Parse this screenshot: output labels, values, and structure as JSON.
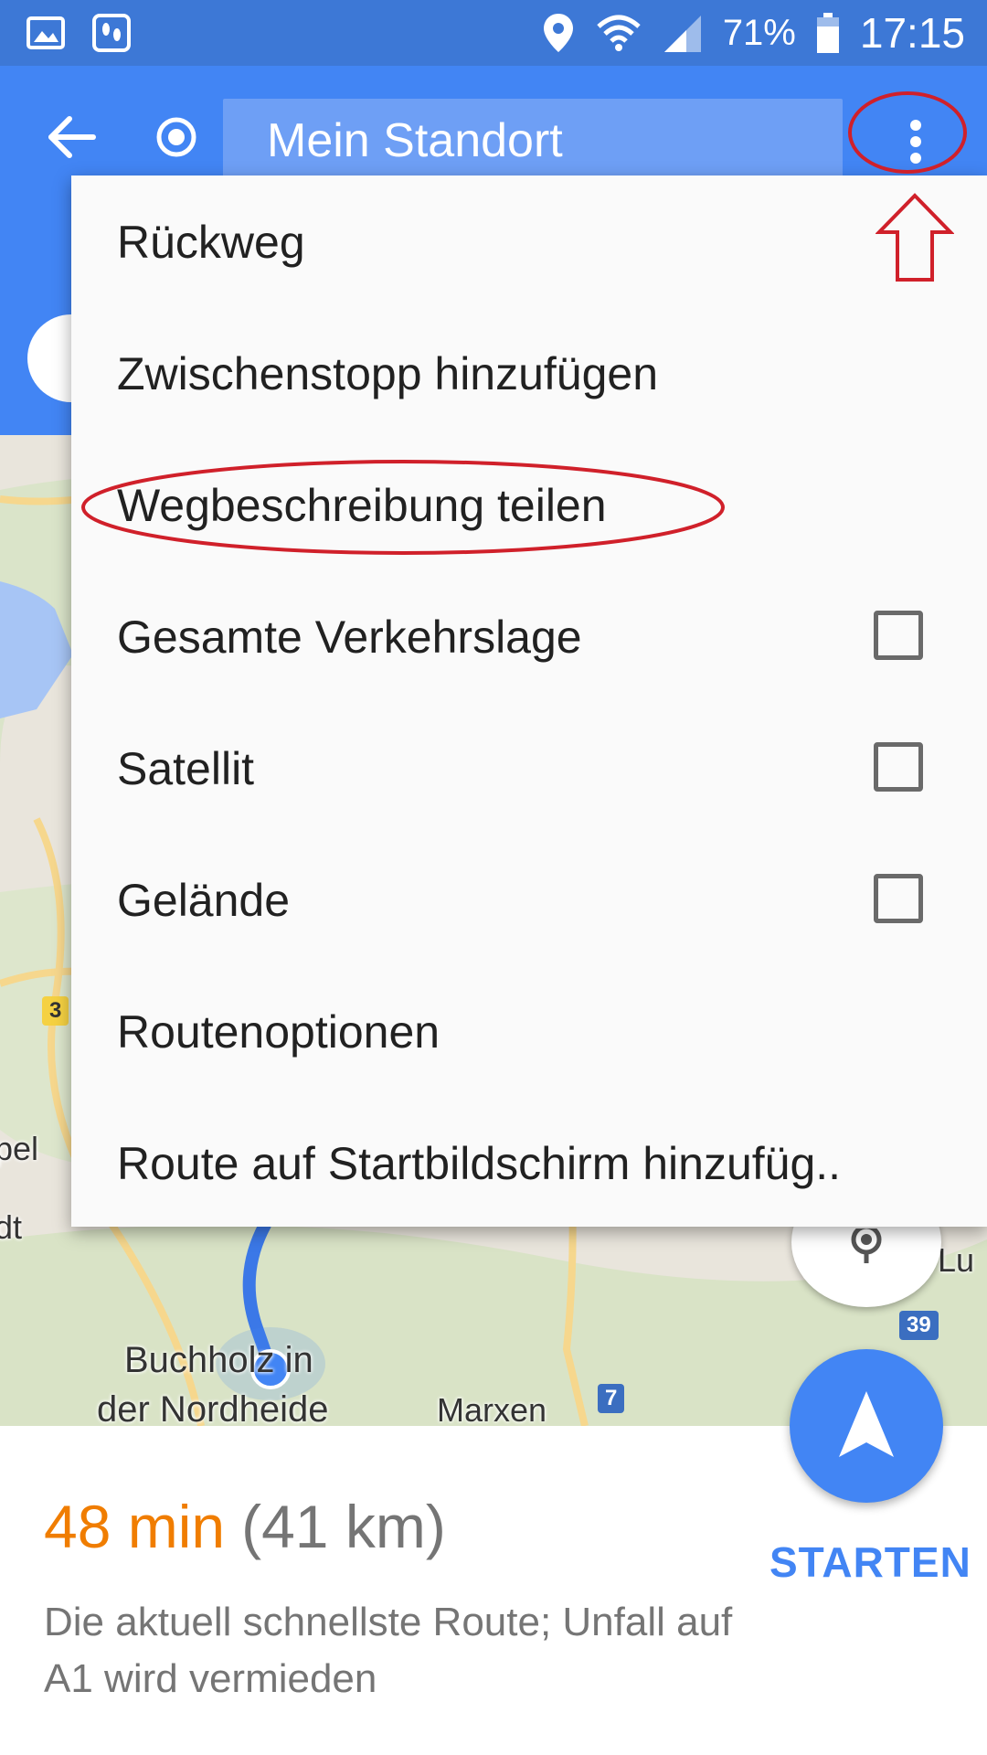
{
  "status_bar": {
    "battery_percent": "71%",
    "time": "17:15",
    "icons": [
      "gallery-icon",
      "footsteps-icon",
      "location-pin-icon",
      "wifi-icon",
      "signal-icon",
      "battery-icon"
    ]
  },
  "app_bar": {
    "origin_field": "Mein Standort"
  },
  "menu": {
    "items": [
      {
        "label": "Rückweg"
      },
      {
        "label": "Zwischenstopp hinzufügen"
      },
      {
        "label": "Wegbeschreibung teilen"
      },
      {
        "label": "Gesamte Verkehrslage"
      },
      {
        "label": "Satellit"
      },
      {
        "label": "Gelände"
      },
      {
        "label": "Routenoptionen"
      },
      {
        "label": "Route auf Startbildschirm hinzufüg.."
      }
    ]
  },
  "map": {
    "labels": {
      "buchholz_1": "Buchholz in",
      "buchholz_2": "der Nordheide",
      "marxen": "Marxen",
      "pel": "pel",
      "dt": "dt",
      "lu": "Lu"
    },
    "shields": {
      "a7": "7",
      "a39": "39",
      "b3": "3"
    }
  },
  "route_summary": {
    "duration": "48 min",
    "distance": "(41 km)",
    "description": "Die aktuell schnellste Route; Unfall auf A1 wird vermieden",
    "start_label": "STARTEN"
  },
  "colors": {
    "status_bar": "#3d78d6",
    "app_bar": "#4285f4",
    "eta": "#f07d00",
    "annotation": "#d0202a"
  }
}
